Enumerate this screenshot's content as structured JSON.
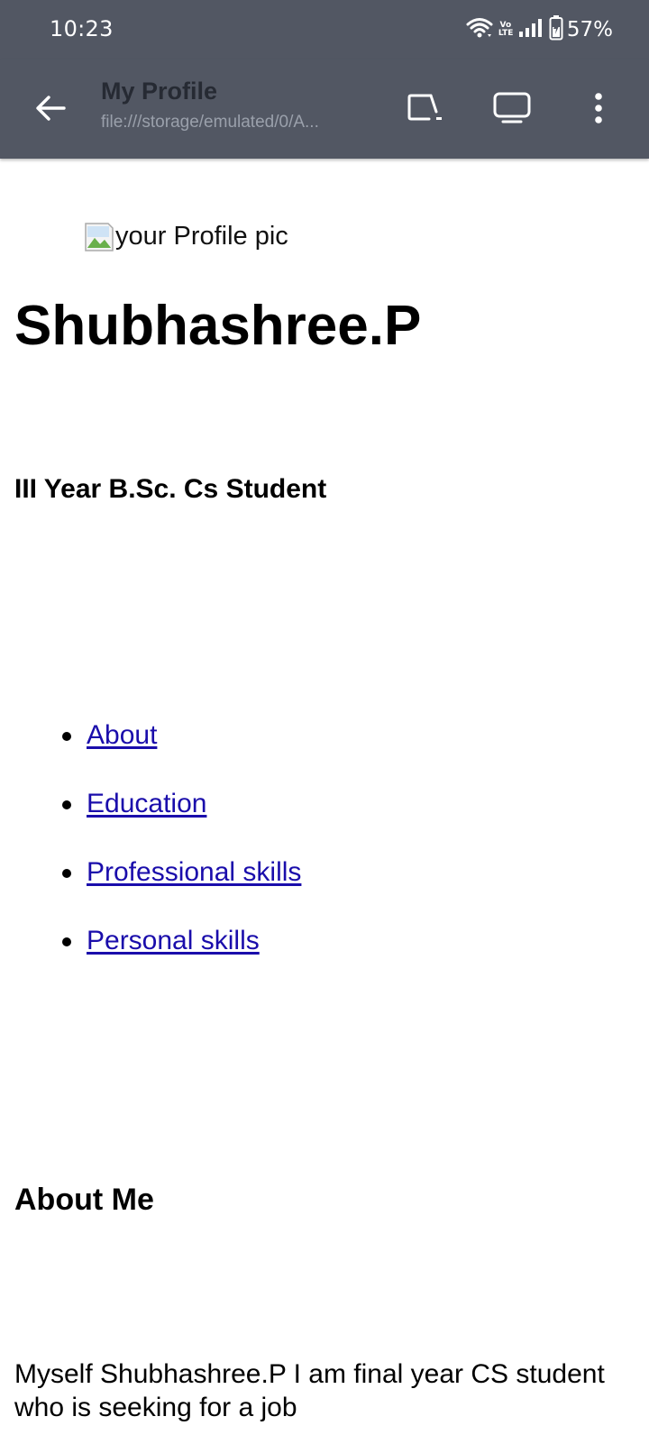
{
  "status_bar": {
    "time": "10:23",
    "battery": "57%",
    "volte": "Vo LTE",
    "icons": [
      "wifi-icon",
      "volte-icon",
      "signal-icon",
      "battery-charging-icon"
    ]
  },
  "toolbar": {
    "title": "My Profile",
    "url": "file:///storage/emulated/0/A...",
    "icons": [
      "back-arrow-icon",
      "open-in-app-icon",
      "desktop-site-icon",
      "more-vert-icon"
    ]
  },
  "page": {
    "profile_pic_alt": "your Profile pic",
    "name": "Shubhashree.P",
    "role": "III Year B.Sc. Cs Student",
    "nav_links": [
      {
        "label": "About"
      },
      {
        "label": "Education"
      },
      {
        "label": "Professional skills"
      },
      {
        "label": "Personal skills"
      }
    ],
    "about_heading": "About Me",
    "about_text": "Myself Shubhashree.P I am final year CS student who is seeking for a job"
  },
  "colors": {
    "toolbar_bg": "#525763",
    "link": "#1a0dab",
    "title_text": "#262a33",
    "url_text": "#9aa0ab"
  }
}
